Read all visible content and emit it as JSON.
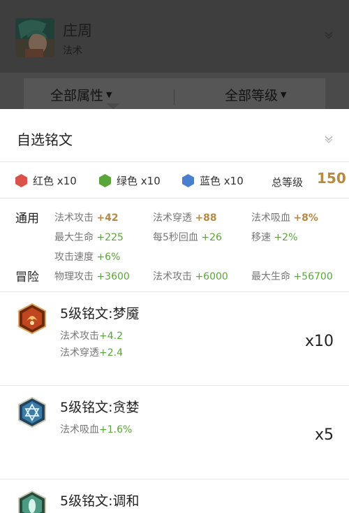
{
  "hero": {
    "name": "庄周",
    "role": "法术",
    "avatar_icon": "hero-portrait"
  },
  "filters": {
    "attribute": "全部属性",
    "level": "全部等级"
  },
  "selector": {
    "title": "自选铭文"
  },
  "colors": [
    {
      "label": "红色 x10",
      "color": "#d9534a"
    },
    {
      "label": "绿色 x10",
      "color": "#5aa53a"
    },
    {
      "label": "蓝色 x10",
      "color": "#4a7fd0"
    }
  ],
  "total": {
    "label": "总等级",
    "value": "150"
  },
  "stats": {
    "general_label": "通用",
    "adventure_label": "冒险",
    "general": [
      {
        "name": "法术攻击",
        "value": "+42",
        "style": "gold"
      },
      {
        "name": "法术穿透",
        "value": "+88",
        "style": "gold"
      },
      {
        "name": "法术吸血",
        "value": "+8%",
        "style": "gold"
      },
      {
        "name": "最大生命",
        "value": "+225",
        "style": "green"
      },
      {
        "name": "每5秒回血",
        "value": "+26",
        "style": "green"
      },
      {
        "name": "移速",
        "value": "+2%",
        "style": "green"
      },
      {
        "name": "攻击速度",
        "value": "+6%",
        "style": "green"
      }
    ],
    "adventure": [
      {
        "name": "物理攻击",
        "value": "+3600"
      },
      {
        "name": "法术攻击",
        "value": "+6000"
      },
      {
        "name": "最大生命",
        "value": "+56700"
      }
    ]
  },
  "runes": [
    {
      "name": "5级铭文:梦魇",
      "effects": [
        {
          "name": "法术攻击",
          "value": "+4.2"
        },
        {
          "name": "法术穿透",
          "value": "+2.4"
        }
      ],
      "qty": "x10",
      "icon": "red-rune-icon"
    },
    {
      "name": "5级铭文:贪婪",
      "effects": [
        {
          "name": "法术吸血",
          "value": "+1.6%"
        }
      ],
      "qty": "x5",
      "icon": "blue-rune-icon"
    },
    {
      "name": "5级铭文:调和",
      "effects": [],
      "qty": "",
      "icon": "green-rune-icon"
    }
  ]
}
